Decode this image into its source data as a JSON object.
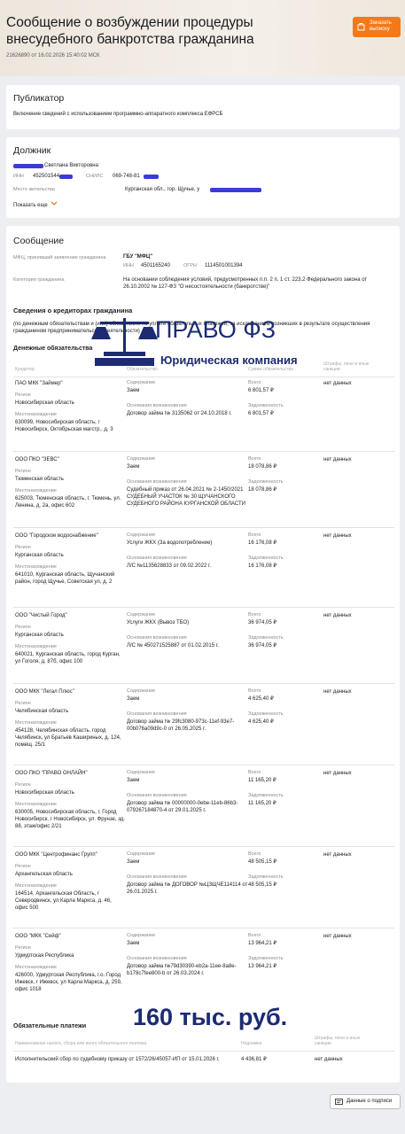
{
  "header": {
    "title": "Сообщение о возбуждении процедуры внесудебного банкротства гражданина",
    "meta": "21626890 от 16.02.2026 15:40:02 МСК",
    "order_button": "Заказать выписку"
  },
  "publisher": {
    "title": "Публикатор",
    "text": "Включение сведений с использованием программно-аппаратного комплекса ЕФРСБ"
  },
  "debtor": {
    "title": "Должник",
    "name": "Светлана Викторовна",
    "inn_label": "ИНН",
    "inn": "452501544",
    "snils_label": "СНИЛС",
    "snils": "069-748-81",
    "residence_label": "Место жительства",
    "residence": "Курганская обл., гор. Щучье, у",
    "show_more": "Показать еще"
  },
  "message": {
    "title": "Сообщение",
    "mfc_label": "МФЦ, принявший заявление гражданина",
    "mfc_name": "ГБУ \"МФЦ\"",
    "mfc_inn_label": "ИНН",
    "mfc_inn": "4501165240",
    "mfc_ogrn_label": "ОГРН",
    "mfc_ogrn": "1114501001394",
    "category_label": "Категория гражданина",
    "category": "На основании соблюдения условий, предусмотренных п.п. 2 п. 1 ст. 223.2 Федерального закона от 26.10.2002 № 127-ФЗ \"О несостоятельности (банкротстве)\"",
    "creditors_title": "Сведения о кредиторах гражданина",
    "creditors_desc": "(по денежным обязательствам и (или) обязанности по уплате обязательных платежей, за исключением возникших в результате осуществления гражданином предпринимательской деятельности)",
    "monetary_title": "Денежные обязательства",
    "columns": [
      "Кредитор",
      "Обязательство",
      "Сумма обязательства",
      "Штрафы, пени и иные санкции"
    ],
    "labels": {
      "region": "Регион",
      "location": "Местонахождение",
      "content": "Содержание",
      "basis": "Основания возникновения",
      "total": "Всего",
      "debt": "Задолженность"
    },
    "creditors": [
      {
        "name": "ПАО МКК \"Займер\"",
        "region": "Новосибирская область",
        "address": "630099, Новосибирская область, г Новосибирск, Октябрьская магстр., д. 3",
        "content": "Заем",
        "basis": "Договор займа № 3135062 от 24.10.2018 г.",
        "total": "6 801,57 ₽",
        "debt": "6 801,57 ₽",
        "fines": "нет данных"
      },
      {
        "name": "ООО ПКО \"ЗЕВС\"",
        "region": "Тюменская область",
        "address": "625003, Тюменская область, г. Тюмень, ул. Ленина, д. 2а, офис 602",
        "content": "Заем",
        "basis": "Судебный приказ от 26.04.2021 № 2-1450/2021 СУДЕБНЫЙ УЧАСТОК № 30 ЩУЧАНСКОГО СУДЕБНОГО РАЙОНА КУРГАНСКОЙ ОБЛАСТИ",
        "total": "18 078,86 ₽",
        "debt": "18 078,86 ₽",
        "fines": "нет данных"
      },
      {
        "name": "ООО \"Городское водоснабжение\"",
        "region": "Курганская область",
        "address": "641010, Курганская область, Щучанский район, город Щучье, Советская ул, д. 2",
        "content": "Услуги ЖКХ (За водопотребление)",
        "basis": "Л/С №1135628833 от 09.02.2022 г.",
        "total": "16 176,08 ₽",
        "debt": "16 176,08 ₽",
        "fines": "нет данных"
      },
      {
        "name": "ООО \"Чистый Город\"",
        "region": "Курганская область",
        "address": "640021, Курганская область, город Курган, ул Гоголя, д. 87б, офис 100",
        "content": "Услуги ЖКХ (Вывоз ТБО)",
        "basis": "Л/С № 450271525887 от 01.02.2015 г.",
        "total": "36 974,05 ₽",
        "debt": "36 974,05 ₽",
        "fines": "нет данных"
      },
      {
        "name": "ООО МКК \"Легал Плюс\"",
        "region": "Челябинская область",
        "address": "454128, Челябинская область, город Челябинск, ул Братьев Кашириных, д. 124, помещ. 25/1",
        "content": "Заем",
        "basis": "Договор займа № 29fc3080-973c-11ef-93e7-00b076a09d9c-0 от 26.05.2025 г.",
        "total": "4 625,40 ₽",
        "debt": "4 625,40 ₽",
        "fines": "нет данных"
      },
      {
        "name": "ООО ПКО \"ПРАВО ОНЛАЙН\"",
        "region": "Новосибирская область",
        "address": "630005, Новосибирская область, г. Город Новосибирск, г Новосибирск, ул. Фрунзе, зд. 88, этаж/офис 2/21",
        "content": "Заем",
        "basis": "Договор займа № 00000000-0ebe-11eb-86b3-079267184870-4 от 29.01.2025 г.",
        "total": "11 165,20 ₽",
        "debt": "11 165,20 ₽",
        "fines": "нет данных"
      },
      {
        "name": "ООО МКК \"Центрофинанс Групп\"",
        "region": "Архангельская область",
        "address": "164514, Архангельская Область, г Северодвинск, ул Карла Маркса, д. 46, офис 500",
        "content": "Заем",
        "basis": "Договор займа № ДОГОВОР №ЦЗЩЧЕ114114 от 26.01.2025 г.",
        "total": "48 505,15 ₽",
        "debt": "48 505,15 ₽",
        "fines": "нет данных"
      },
      {
        "name": "ООО \"МКК \"Сейф\"",
        "region": "Удмуртская Республика",
        "address": "426000, Удмуртская Республика, г.о. Город Ижевск, г Ижевск, ул Карла Маркса, д. 259, офис 1018",
        "content": "Заем",
        "basis": "Договор займа №79d30390-eb2a-11ee-8a8e-b178c7fee800-b от 26.03.2024 г.",
        "total": "13 964,21 ₽",
        "debt": "13 964,21 ₽",
        "fines": "нет данных"
      }
    ],
    "mandatory_title": "Обязательные платежи",
    "mandatory_columns": [
      "Наименование налога, сбора или иного обязательного платежа",
      "Недоимка",
      "Штрафы, пени и иные санкции"
    ],
    "mandatory": {
      "name": "Исполнительский сбор по судебному приказу от 1572/26/45057-ИП от 15.01.2026 г.",
      "arrears": "4 436,81 ₽",
      "fines": "нет данных"
    }
  },
  "watermark": {
    "brand": "ПРАВО ФЗ",
    "subtitle": "Юридическая компания",
    "amount": "160 тыс. руб.",
    "color": "#1c2b72"
  },
  "signature_button": "Данные о подписи",
  "colors": {
    "accent": "#f27a1a",
    "redaction": "#3b3bd8"
  }
}
